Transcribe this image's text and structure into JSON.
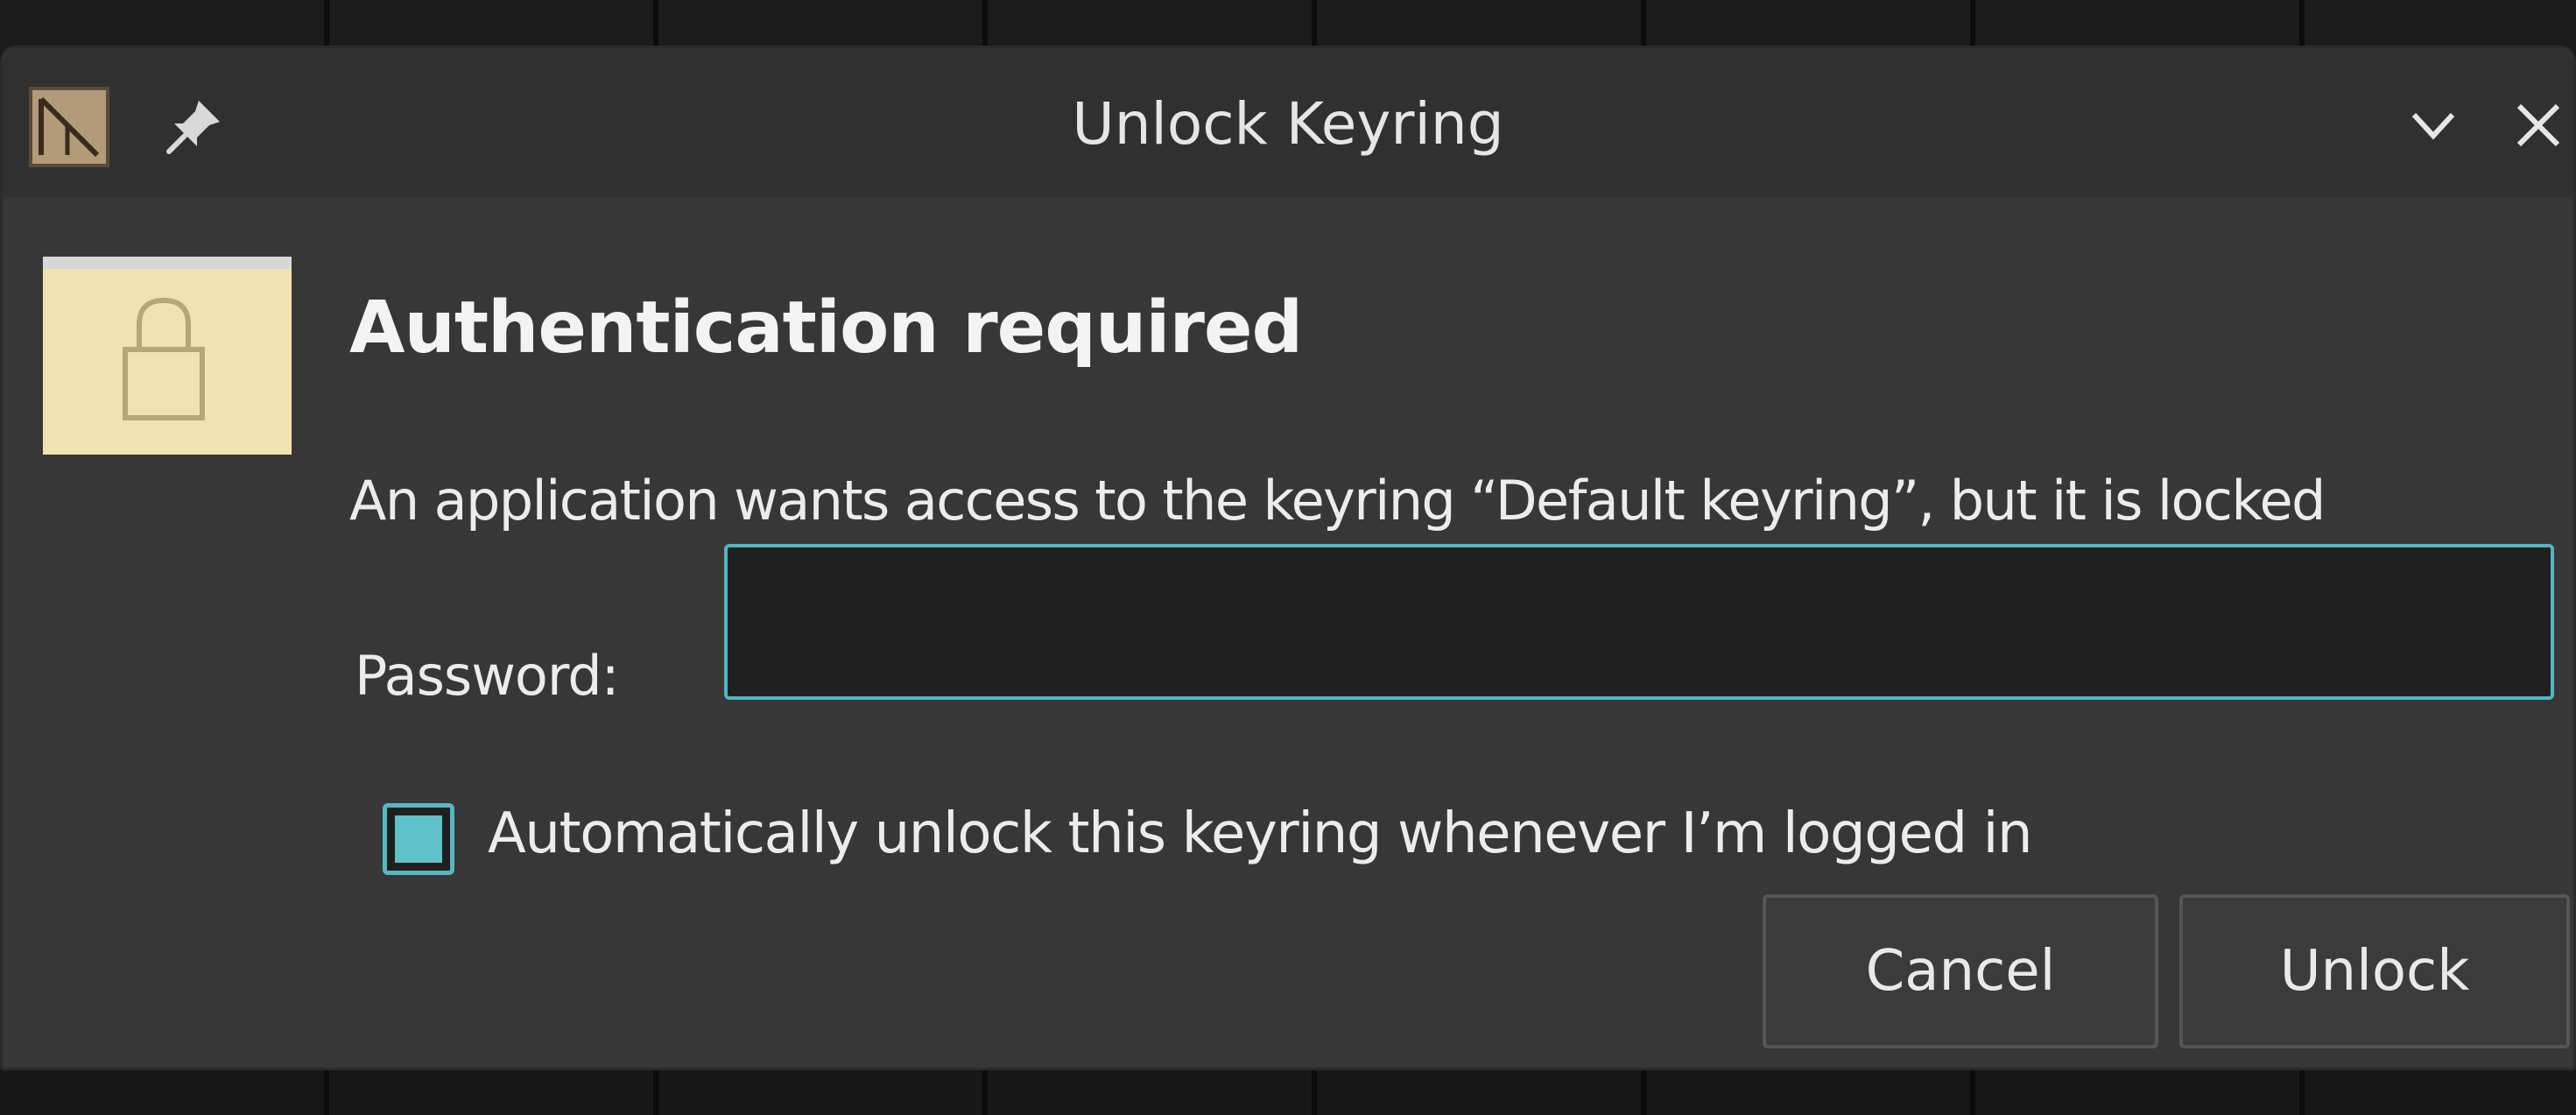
{
  "window": {
    "title": "Unlock Keyring"
  },
  "titlebar": {
    "app_icon": "keyring-app-icon",
    "pin_icon": "pin-icon",
    "minimize_icon": "chevron-down-icon",
    "close_icon": "close-icon"
  },
  "dialog": {
    "icon": "lock-icon",
    "heading": "Authentication required",
    "message": "An application wants access to the keyring “Default keyring”, but it is locked",
    "password_label": "Password:",
    "password_value": "",
    "auto_unlock": {
      "label": "Automatically unlock this keyring whenever I’m logged in",
      "checked": true
    },
    "buttons": {
      "cancel": "Cancel",
      "unlock": "Unlock"
    }
  },
  "colors": {
    "accent": "#4fb7bf",
    "dialog_bg": "#373737",
    "icon_bg": "#f0e2b2"
  }
}
